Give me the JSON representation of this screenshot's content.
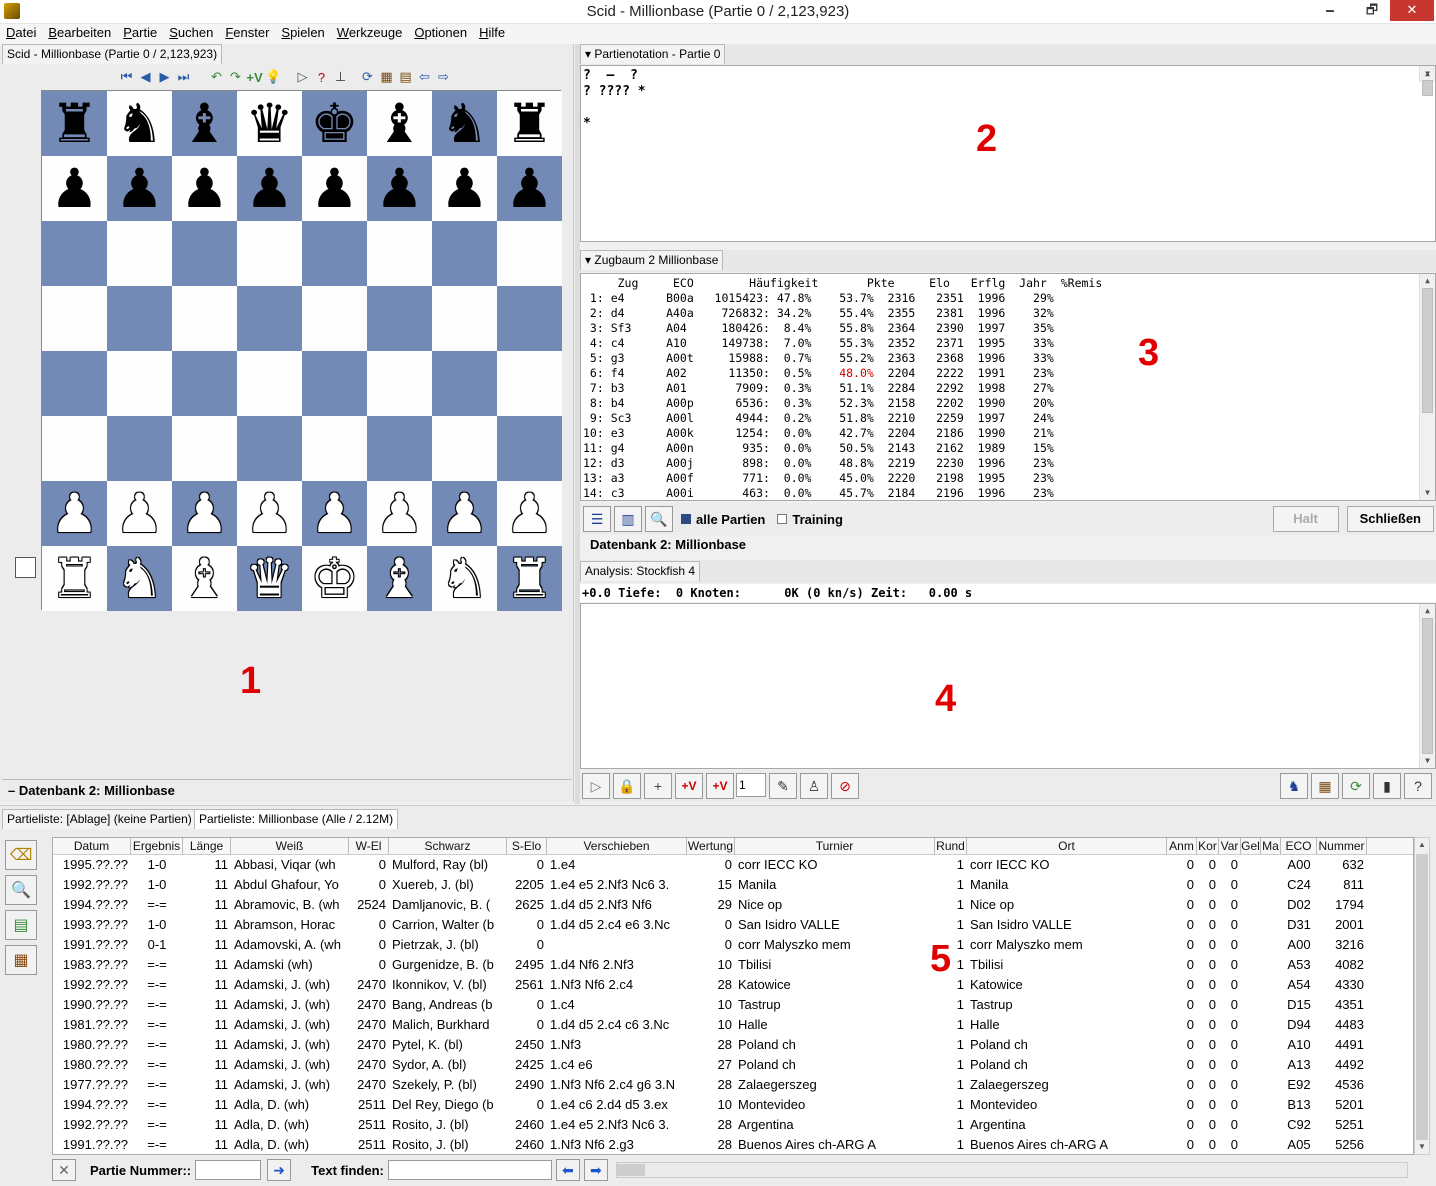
{
  "window": {
    "title": "Scid - Millionbase (Partie 0 / 2,123,923)",
    "min": "🗕",
    "max": "🗗",
    "close": "✕"
  },
  "menu": [
    "Datei",
    "Bearbeiten",
    "Partie",
    "Suchen",
    "Fenster",
    "Spielen",
    "Werkzeuge",
    "Optionen",
    "Hilfe"
  ],
  "board_pane": {
    "tab": "Scid - Millionbase (Partie 0 / 2,123,923)",
    "status": "–  Datenbank 2: Millionbase",
    "label_number": "1",
    "rows": [
      [
        "♜",
        "♞",
        "♝",
        "♛",
        "♚",
        "♝",
        "♞",
        "♜"
      ],
      [
        "♟",
        "♟",
        "♟",
        "♟",
        "♟",
        "♟",
        "♟",
        "♟"
      ],
      [
        "",
        "",
        "",
        "",
        "",
        "",
        "",
        ""
      ],
      [
        "",
        "",
        "",
        "",
        "",
        "",
        "",
        ""
      ],
      [
        "",
        "",
        "",
        "",
        "",
        "",
        "",
        ""
      ],
      [
        "",
        "",
        "",
        "",
        "",
        "",
        "",
        ""
      ],
      [
        "♟",
        "♟",
        "♟",
        "♟",
        "♟",
        "♟",
        "♟",
        "♟"
      ],
      [
        "♜",
        "♞",
        "♝",
        "♛",
        "♚",
        "♝",
        "♞",
        "♜"
      ]
    ]
  },
  "notation": {
    "tab": "Partienotation - Partie 0",
    "lines": [
      "?  –  ?",
      "? ???? *",
      "",
      "*"
    ],
    "label_number": "2"
  },
  "tree": {
    "tab": "Zugbaum 2 Millionbase",
    "header": "     Zug     ECO        Häufigkeit       Pkte     Elo   Erflg  Jahr  %Remis",
    "rows": [
      {
        "pre": " 1: e4      B00a   1015423: 47.8%    ",
        "pkte": "53.7%",
        "post": "  2316   2351  1996    29%",
        "red": false
      },
      {
        "pre": " 2: d4      A40a    726832: 34.2%    ",
        "pkte": "55.4%",
        "post": "  2355   2381  1996    32%",
        "red": false
      },
      {
        "pre": " 3: Sf3     A04     180426:  8.4%    ",
        "pkte": "55.8%",
        "post": "  2364   2390  1997    35%",
        "red": false
      },
      {
        "pre": " 4: c4      A10     149738:  7.0%    ",
        "pkte": "55.3%",
        "post": "  2352   2371  1995    33%",
        "red": false
      },
      {
        "pre": " 5: g3      A00t     15988:  0.7%    ",
        "pkte": "55.2%",
        "post": "  2363   2368  1996    33%",
        "red": false
      },
      {
        "pre": " 6: f4      A02      11350:  0.5%    ",
        "pkte": "48.0%",
        "post": "  2204   2222  1991    23%",
        "red": true
      },
      {
        "pre": " 7: b3      A01       7909:  0.3%    ",
        "pkte": "51.1%",
        "post": "  2284   2292  1998    27%",
        "red": false
      },
      {
        "pre": " 8: b4      A00p      6536:  0.3%    ",
        "pkte": "52.3%",
        "post": "  2158   2202  1990    20%",
        "red": false
      },
      {
        "pre": " 9: Sc3     A00l      4944:  0.2%    ",
        "pkte": "51.8%",
        "post": "  2210   2259  1997    24%",
        "red": false
      },
      {
        "pre": "10: e3      A00k      1254:  0.0%    ",
        "pkte": "42.7%",
        "post": "  2204   2186  1990    21%",
        "red": false
      },
      {
        "pre": "11: g4      A00n       935:  0.0%    ",
        "pkte": "50.5%",
        "post": "  2143   2162  1989    15%",
        "red": false
      },
      {
        "pre": "12: d3      A00j       898:  0.0%    ",
        "pkte": "48.8%",
        "post": "  2219   2230  1996    23%",
        "red": false
      },
      {
        "pre": "13: a3      A00f       771:  0.0%    ",
        "pkte": "45.0%",
        "post": "  2220   2198  1995    23%",
        "red": false
      },
      {
        "pre": "14: c3      A00i       463:  0.0%    ",
        "pkte": "45.7%",
        "post": "  2184   2196  1996    23%",
        "red": false
      }
    ],
    "all_games": "alle Partien",
    "training": "Training",
    "halt": "Halt",
    "close": "Schließen",
    "db_status": "Datenbank 2: Millionbase",
    "label_number": "3"
  },
  "analysis": {
    "tab": "Analysis: Stockfish 4",
    "header": "+0.0 Tiefe:  0 Knoten:      0K (0 kn/s) Zeit:   0.00 s",
    "label_number": "4",
    "multipv": "1"
  },
  "gamelist": {
    "tab1": "Partieliste: [Ablage] (keine Partien)",
    "tab2": "Partieliste: Millionbase (Alle / 2.12M)",
    "label_number": "5",
    "columns": [
      "Datum",
      "Ergebnis",
      "Länge",
      "Weiß",
      "W-El",
      "Schwarz",
      "S-Elo",
      "Verschieben",
      "Wertung",
      "Turnier",
      "Rund",
      "Ort",
      "Anm",
      "Kor",
      "Var",
      "Gel",
      "Ma",
      "ECO",
      "Nummer"
    ],
    "rows": [
      [
        "1995.??.??",
        "1-0",
        "11",
        "Abbasi, Viqar (wh",
        "0",
        "Mulford, Ray (bl)",
        "0",
        "1.e4",
        "0",
        "corr IECC KO",
        "1",
        "corr IECC KO",
        "0",
        "0",
        "0",
        "",
        "",
        "A00",
        "632"
      ],
      [
        "1992.??.??",
        "1-0",
        "11",
        "Abdul Ghafour, Yo",
        "0",
        "Xuereb, J. (bl)",
        "2205",
        "1.e4 e5 2.Nf3 Nc6 3.",
        "15",
        "Manila",
        "1",
        "Manila",
        "0",
        "0",
        "0",
        "",
        "",
        "C24",
        "811"
      ],
      [
        "1994.??.??",
        "=-=",
        "11",
        "Abramovic, B. (wh",
        "2524",
        "Damljanovic, B. (",
        "2625",
        "1.d4 d5 2.Nf3 Nf6",
        "29",
        "Nice op",
        "1",
        "Nice op",
        "0",
        "0",
        "0",
        "",
        "",
        "D02",
        "1794"
      ],
      [
        "1993.??.??",
        "1-0",
        "11",
        "Abramson, Horac",
        "0",
        "Carrion, Walter (b",
        "0",
        "1.d4 d5 2.c4 e6 3.Nc",
        "0",
        "San Isidro VALLE",
        "1",
        "San Isidro VALLE",
        "0",
        "0",
        "0",
        "",
        "",
        "D31",
        "2001"
      ],
      [
        "1991.??.??",
        "0-1",
        "11",
        "Adamovski, A. (wh",
        "0",
        "Pietrzak, J. (bl)",
        "0",
        "",
        "0",
        "corr Malyszko mem",
        "1",
        "corr Malyszko mem",
        "0",
        "0",
        "0",
        "",
        "",
        "A00",
        "3216"
      ],
      [
        "1983.??.??",
        "=-=",
        "11",
        "Adamski (wh)",
        "0",
        "Gurgenidze, B. (b",
        "2495",
        "1.d4 Nf6 2.Nf3",
        "10",
        "Tbilisi",
        "1",
        "Tbilisi",
        "0",
        "0",
        "0",
        "",
        "",
        "A53",
        "4082"
      ],
      [
        "1992.??.??",
        "=-=",
        "11",
        "Adamski, J. (wh)",
        "2470",
        "Ikonnikov, V. (bl)",
        "2561",
        "1.Nf3 Nf6 2.c4",
        "28",
        "Katowice",
        "1",
        "Katowice",
        "0",
        "0",
        "0",
        "",
        "",
        "A54",
        "4330"
      ],
      [
        "1990.??.??",
        "=-=",
        "11",
        "Adamski, J. (wh)",
        "2470",
        "Bang, Andreas (b",
        "0",
        "1.c4",
        "10",
        "Tastrup",
        "1",
        "Tastrup",
        "0",
        "0",
        "0",
        "",
        "",
        "D15",
        "4351"
      ],
      [
        "1981.??.??",
        "=-=",
        "11",
        "Adamski, J. (wh)",
        "2470",
        "Malich, Burkhard",
        "0",
        "1.d4 d5 2.c4 c6 3.Nc",
        "10",
        "Halle",
        "1",
        "Halle",
        "0",
        "0",
        "0",
        "",
        "",
        "D94",
        "4483"
      ],
      [
        "1980.??.??",
        "=-=",
        "11",
        "Adamski, J. (wh)",
        "2470",
        "Pytel, K. (bl)",
        "2450",
        "1.Nf3",
        "28",
        "Poland ch",
        "1",
        "Poland ch",
        "0",
        "0",
        "0",
        "",
        "",
        "A10",
        "4491"
      ],
      [
        "1980.??.??",
        "=-=",
        "11",
        "Adamski, J. (wh)",
        "2470",
        "Sydor, A. (bl)",
        "2425",
        "1.c4 e6",
        "27",
        "Poland ch",
        "1",
        "Poland ch",
        "0",
        "0",
        "0",
        "",
        "",
        "A13",
        "4492"
      ],
      [
        "1977.??.??",
        "=-=",
        "11",
        "Adamski, J. (wh)",
        "2470",
        "Szekely, P. (bl)",
        "2490",
        "1.Nf3 Nf6 2.c4 g6 3.N",
        "28",
        "Zalaegerszeg",
        "1",
        "Zalaegerszeg",
        "0",
        "0",
        "0",
        "",
        "",
        "E92",
        "4536"
      ],
      [
        "1994.??.??",
        "=-=",
        "11",
        "Adla, D. (wh)",
        "2511",
        "Del Rey, Diego (b",
        "0",
        "1.e4 c6 2.d4 d5 3.ex",
        "10",
        "Montevideo",
        "1",
        "Montevideo",
        "0",
        "0",
        "0",
        "",
        "",
        "B13",
        "5201"
      ],
      [
        "1992.??.??",
        "=-=",
        "11",
        "Adla, D. (wh)",
        "2511",
        "Rosito, J. (bl)",
        "2460",
        "1.e4 e5 2.Nf3 Nc6 3.",
        "28",
        "Argentina",
        "1",
        "Argentina",
        "0",
        "0",
        "0",
        "",
        "",
        "C92",
        "5251"
      ],
      [
        "1991.??.??",
        "=-=",
        "11",
        "Adla, D. (wh)",
        "2511",
        "Rosito, J. (bl)",
        "2460",
        "1.Nf3 Nf6 2.g3",
        "28",
        "Buenos Aires ch-ARG A",
        "1",
        "Buenos Aires ch-ARG A",
        "0",
        "0",
        "0",
        "",
        "",
        "A05",
        "5256"
      ]
    ],
    "game_number_label": "Partie Nummer::",
    "find_text_label": "Text finden:"
  },
  "colors": {
    "dark_square": "#7389b6",
    "light_square": "#fefefe",
    "label_red": "#e00000"
  }
}
